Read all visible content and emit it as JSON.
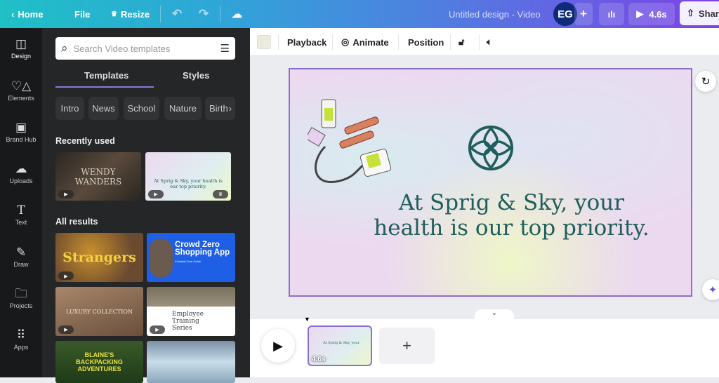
{
  "topbar": {
    "home": "Home",
    "file": "File",
    "resize": "Resize",
    "title": "Untitled design - Video",
    "avatar": "EG",
    "duration": "4.6s",
    "share": "Share"
  },
  "rail": [
    {
      "label": "Design",
      "icon": "layout-icon"
    },
    {
      "label": "Elements",
      "icon": "shapes-icon"
    },
    {
      "label": "Brand Hub",
      "icon": "brand-icon"
    },
    {
      "label": "Uploads",
      "icon": "cloud-upload-icon"
    },
    {
      "label": "Text",
      "icon": "text-icon"
    },
    {
      "label": "Draw",
      "icon": "pen-icon"
    },
    {
      "label": "Projects",
      "icon": "folder-icon"
    },
    {
      "label": "Apps",
      "icon": "grid-icon"
    }
  ],
  "panel": {
    "search_placeholder": "Search Video templates",
    "tabs": [
      "Templates",
      "Styles"
    ],
    "chips": [
      "Intro",
      "News",
      "School",
      "Nature",
      "Birth"
    ],
    "recently_used": "Recently used",
    "all_results": "All results",
    "recent": [
      {
        "title": "WENDY WANDERS"
      },
      {
        "title": "At Sprig & Sky, your health is our top priority."
      }
    ],
    "results": [
      {
        "title": "Strangers"
      },
      {
        "title": "Crowd Zero Shopping App",
        "sub": "A Hassle-Free Guide"
      },
      {
        "title": "LUXURY COLLECTION"
      },
      {
        "title": "Employee Training Series"
      },
      {
        "title": "BLAINE'S BACKPACKING ADVENTURES"
      },
      {
        "title": ""
      }
    ]
  },
  "toolbar": {
    "color": "#ecebdf",
    "playback": "Playback",
    "animate": "Animate",
    "position": "Position"
  },
  "design": {
    "headline_1": "At Sprig & Sky, your",
    "headline_2": "health is our top priority.",
    "brand_color": "#1f5e5c"
  },
  "timeline": {
    "clip_duration": "4.6s",
    "add": "+"
  }
}
